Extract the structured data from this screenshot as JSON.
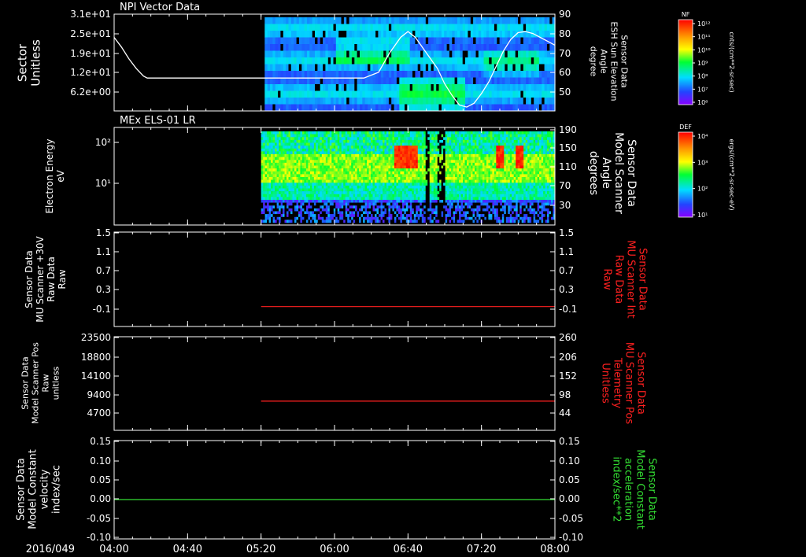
{
  "colors": {
    "background": "#000000",
    "axes": "#ffffff",
    "scanner_red": "#ff2020",
    "constant_green": "#33dd33",
    "elevation_line": "#ffffff"
  },
  "time_axis": {
    "date": "2016/049",
    "ticks": [
      "04:00",
      "04:40",
      "05:20",
      "06:00",
      "06:40",
      "07:20",
      "08:00"
    ],
    "range_minutes": [
      240,
      480
    ],
    "tick_minutes": [
      240,
      280,
      320,
      360,
      400,
      440,
      480
    ]
  },
  "colorbars": [
    {
      "title": "NF",
      "units": "cnts/(cm**2-sr-sec)",
      "ticks": [
        "10¹²",
        "10¹¹",
        "10¹⁰",
        "10⁹",
        "10⁸",
        "10⁷",
        "10⁶"
      ]
    },
    {
      "title": "DEF",
      "units": "ergs/(cm**2-sr-sec-eV)",
      "ticks": [
        "10⁴",
        "10³",
        "10²",
        "10¹"
      ]
    }
  ],
  "chart_data": [
    {
      "type": "heatmap",
      "title": "NPI Vector Data",
      "ylabel": [
        "Sector",
        "Unitless"
      ],
      "yticks": [
        "3.1e+01",
        "2.5e+01",
        "1.9e+01",
        "1.2e+01",
        "6.2e+00"
      ],
      "ylim": [
        0,
        31
      ],
      "data_start_minute": 322,
      "series": [
        {
          "name": "ESH Sun Elevation Angle",
          "type": "line",
          "axis": "right",
          "y2label": [
            "Sensor Data",
            "ESH Sun Elevation",
            "Angle",
            "degree"
          ],
          "y2ticks": [
            "90",
            "80",
            "70",
            "60",
            "50"
          ],
          "y2lim": [
            40,
            90
          ],
          "x_minutes": [
            240,
            244,
            248,
            252,
            256,
            258,
            262,
            270,
            280,
            300,
            320,
            340,
            360,
            376,
            384,
            390,
            396,
            400,
            404,
            410,
            416,
            420,
            424,
            428,
            432,
            436,
            440,
            444,
            448,
            452,
            456,
            460,
            464,
            468,
            472,
            476,
            480
          ],
          "values": [
            78,
            73,
            67,
            62,
            58,
            57,
            57,
            57,
            57,
            57,
            57,
            57,
            57,
            57,
            60,
            70,
            78,
            81,
            78,
            70,
            62,
            54,
            48,
            43,
            42,
            44,
            49,
            55,
            63,
            71,
            77,
            80.5,
            81,
            80,
            78,
            76,
            74
          ]
        }
      ]
    },
    {
      "type": "heatmap",
      "title": "MEx ELS-01 LR",
      "ylabel": [
        "Electron Energy",
        "eV"
      ],
      "yticks": [
        "10²",
        "10¹"
      ],
      "ylog": true,
      "ylim": [
        1,
        200
      ],
      "data_start_minute": 320,
      "enhancements_minutes": [
        [
          392,
          405
        ],
        [
          448,
          452
        ],
        [
          458,
          462
        ]
      ],
      "gaps_minutes": [
        [
          409,
          411
        ],
        [
          415,
          420
        ]
      ],
      "series": [
        {
          "name": "Model Scanner Angle",
          "type": "line",
          "axis": "right",
          "y2label": [
            "Sensor Data",
            "Model Scanner",
            "Angle",
            "degrees"
          ],
          "y2ticks": [
            "190",
            "150",
            "110",
            "70",
            "30"
          ],
          "y2lim": [
            10,
            190
          ],
          "x_minutes": [
            240,
            480
          ],
          "values": [
            10,
            10
          ]
        }
      ]
    },
    {
      "type": "line",
      "ylabel": [
        "Sensor Data",
        "MU Scanner +30V",
        "Raw Data",
        "Raw"
      ],
      "yticks": [
        "1.5",
        "1.1",
        "0.7",
        "0.3",
        "-0.1"
      ],
      "ylim": [
        -0.4,
        1.5
      ],
      "y2label": [
        "Sensor Data",
        "MU Scanner Int",
        "Raw Data",
        "Raw"
      ],
      "y2ticks": [
        "1.5",
        "1.1",
        "0.7",
        "0.3",
        "-0.1"
      ],
      "y2lim": [
        -0.4,
        1.5
      ],
      "series": [
        {
          "name": "MU Scanner Int",
          "axis": "right",
          "color": "#ff2020",
          "x_minutes": [
            320,
            480
          ],
          "values": [
            0.0,
            0.0
          ]
        }
      ]
    },
    {
      "type": "line",
      "ylabel": [
        "Sensor Data",
        "Model Scanner Pos",
        "Raw",
        "unitless"
      ],
      "yticks": [
        "23500",
        "18800",
        "14100",
        "9400",
        "4700"
      ],
      "ylim": [
        0,
        23500
      ],
      "y2label": [
        "Sensor Data",
        "MU Scanner Pos",
        "Telemetry",
        "Unitless"
      ],
      "y2ticks": [
        "260",
        "206",
        "152",
        "98",
        "44"
      ],
      "y2lim": [
        0,
        260
      ],
      "series": [
        {
          "name": "MU Scanner Pos",
          "axis": "right",
          "color": "#ff2020",
          "x_minutes": [
            320,
            480
          ],
          "values": [
            81,
            81
          ]
        }
      ]
    },
    {
      "type": "line",
      "ylabel": [
        "Sensor Data",
        "Model Constant",
        "velocity",
        "index/sec"
      ],
      "yticks": [
        "0.15",
        "0.10",
        "0.05",
        "0.00",
        "-0.05",
        "-0.10"
      ],
      "ylim": [
        -0.1,
        0.15
      ],
      "y2label": [
        "Sensor Data",
        "Model Constant",
        "acceleration",
        "index/sec**2"
      ],
      "y2ticks": [
        "0.15",
        "0.10",
        "0.05",
        "0.00",
        "-0.05",
        "-0.10"
      ],
      "y2lim": [
        -0.1,
        0.15
      ],
      "series": [
        {
          "name": "Model Constant acceleration",
          "axis": "right",
          "color": "#33dd33",
          "x_minutes": [
            240,
            480
          ],
          "values": [
            0.0,
            0.0
          ]
        }
      ]
    }
  ]
}
